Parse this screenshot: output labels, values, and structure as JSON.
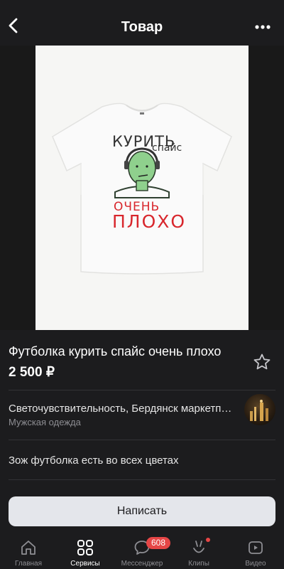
{
  "header": {
    "title": "Товар",
    "back_icon": "chevron-left-icon",
    "more_icon": "more-horizontal-icon"
  },
  "product": {
    "image_icon": "product-photo",
    "print_text": {
      "line1": "КУРИТЬ",
      "line2": "спайс",
      "line3": "ОЧЕНЬ",
      "line4": "ПЛОХО"
    },
    "title": "Футболка курить спайс очень плохо",
    "price": "2 500 ₽",
    "favorite_icon": "star-outline-icon"
  },
  "seller": {
    "name": "Светочувствительность, Бердянск маркетплейс",
    "category": "Мужская одежда"
  },
  "description": "Зож футболка есть во всех цветах",
  "actions": {
    "write_label": "Написать"
  },
  "tabbar": {
    "items": [
      {
        "label": "Главная",
        "icon": "home-icon"
      },
      {
        "label": "Сервисы",
        "icon": "services-grid-icon",
        "active": true
      },
      {
        "label": "Мессенджер",
        "icon": "chat-bubble-icon",
        "badge": "608"
      },
      {
        "label": "Клипы",
        "icon": "clips-icon",
        "dot": true
      },
      {
        "label": "Видео",
        "icon": "video-icon"
      }
    ]
  },
  "colors": {
    "background": "#000000",
    "surface": "#1c1c1e",
    "button": "#e4e6eb",
    "badge": "#e64646",
    "print_red": "#d8262c"
  }
}
